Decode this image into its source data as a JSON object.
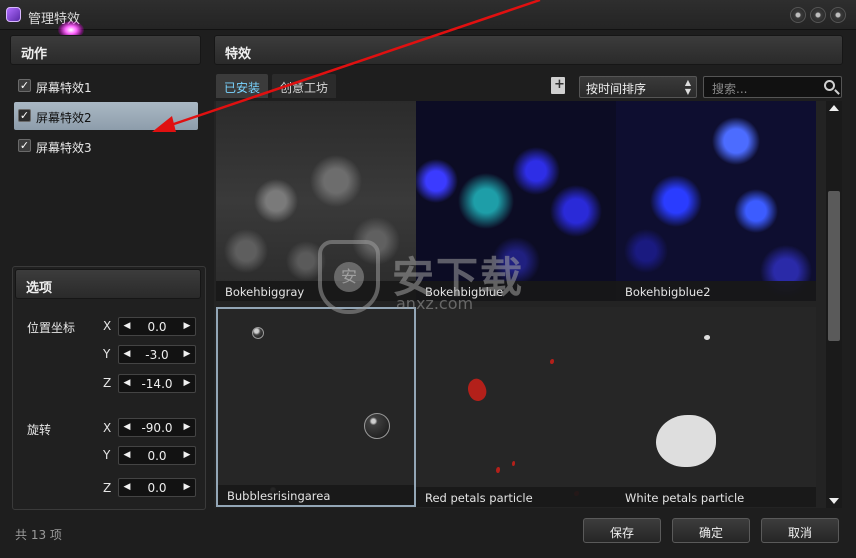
{
  "window": {
    "title": "管理特效"
  },
  "actions_panel": {
    "header": "动作",
    "items": [
      {
        "label": "屏幕特效1",
        "checked": true,
        "selected": false
      },
      {
        "label": "屏幕特效2",
        "checked": true,
        "selected": true
      },
      {
        "label": "屏幕特效3",
        "checked": true,
        "selected": false
      }
    ]
  },
  "options_panel": {
    "header": "选项",
    "position": {
      "label": "位置坐标",
      "x_label": "X",
      "y_label": "Y",
      "z_label": "Z",
      "x": "0.0",
      "y": "-3.0",
      "z": "-14.0"
    },
    "rotation": {
      "label": "旋转",
      "x_label": "X",
      "y_label": "Y",
      "z_label": "Z",
      "x": "-90.0",
      "y": "0.0",
      "z": "0.0"
    }
  },
  "footer": {
    "count": "共 13 项",
    "save": "保存",
    "ok": "确定",
    "cancel": "取消"
  },
  "effects_panel": {
    "header": "特效",
    "tabs": [
      {
        "label": "已安装",
        "active": true
      },
      {
        "label": "创意工坊",
        "active": false
      }
    ],
    "sort": {
      "value": "按时间排序"
    },
    "search": {
      "placeholder": "搜索..."
    },
    "items": [
      {
        "name": "Bokehbiggray"
      },
      {
        "name": "Bokehbigblue"
      },
      {
        "name": "Bokehbigblue2"
      },
      {
        "name": "Bubblesrisingarea",
        "selected": true
      },
      {
        "name": "Red petals particle"
      },
      {
        "name": "White petals particle"
      }
    ]
  },
  "watermark": {
    "text": "安下载",
    "sub": "anxz.com"
  },
  "colors": {
    "accent": "#79d4ff",
    "selection": "#9aaab8",
    "annotation_arrow": "#e01010"
  }
}
